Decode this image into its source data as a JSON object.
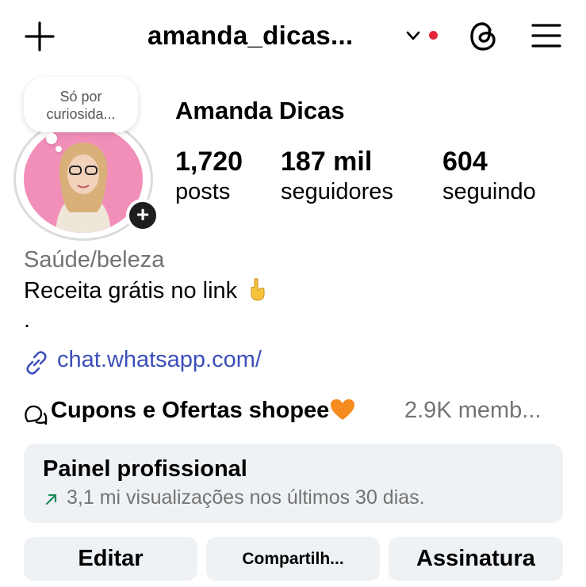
{
  "header": {
    "username": "amanda_dicas...",
    "notification_dot_color": "#e4243b",
    "icons": [
      "plus-icon",
      "chevron-down-icon",
      "threads-icon",
      "menu-icon"
    ]
  },
  "note": {
    "text": "Só por curiosida..."
  },
  "profile": {
    "display_name": "Amanda Dicas",
    "stats": [
      {
        "value": "1,720",
        "label": "posts"
      },
      {
        "value": "187 mil",
        "label": "seguidores"
      },
      {
        "value": "604",
        "label": "seguindo"
      }
    ],
    "category": "Saúde/beleza",
    "bio_line": "Receita grátis no link",
    "bio_dot": ".",
    "link": "chat.whatsapp.com/"
  },
  "channel": {
    "name": "Cupons e Ofertas shopee",
    "members": "2.9K memb..."
  },
  "professional_panel": {
    "title": "Painel profissional",
    "subtitle": "3,1 mi visualizações nos últimos 30 dias.",
    "accent_color": "#1d8a5a"
  },
  "actions": {
    "edit": "Editar",
    "share": "Compartilh...",
    "subscription": "Assinatura"
  }
}
